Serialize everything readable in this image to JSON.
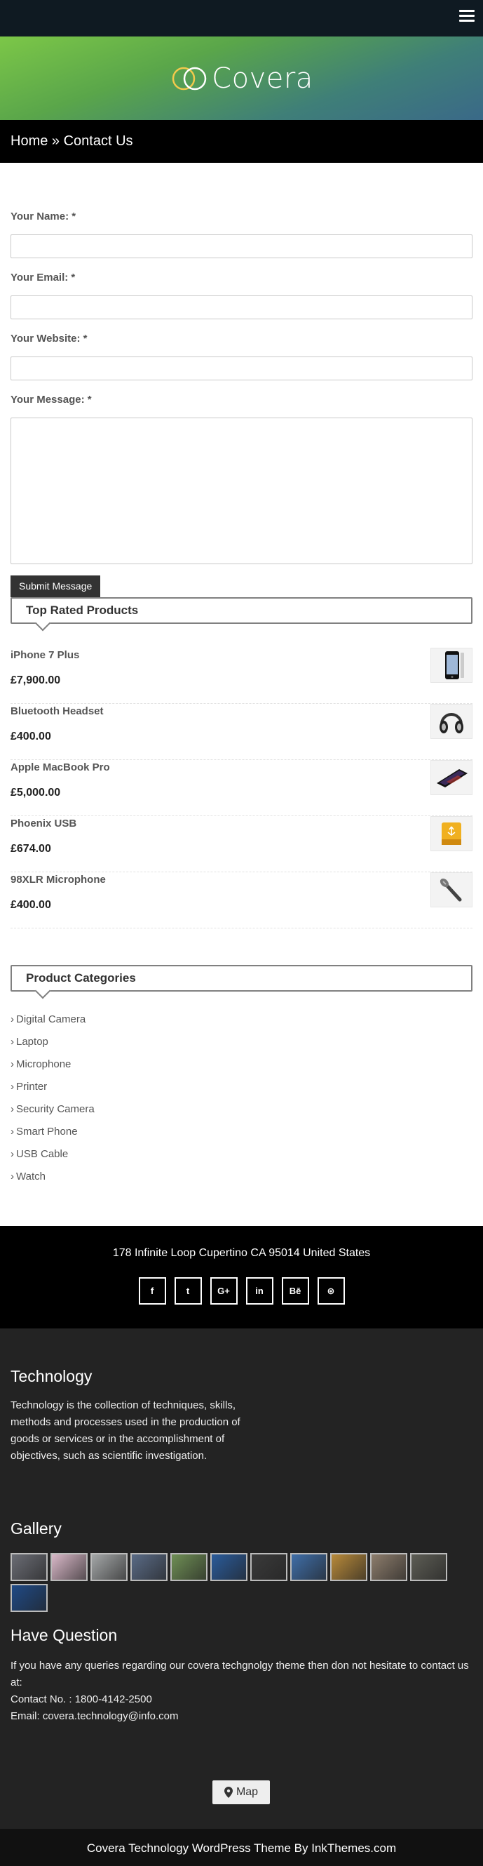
{
  "header": {
    "menu_icon": "hamburger-menu-icon"
  },
  "brand": {
    "name": "Covera",
    "colors": {
      "ring_left": "#f2c94c",
      "ring_right": "#ffffff"
    }
  },
  "breadcrumb": {
    "text": "Home » Contact Us"
  },
  "form": {
    "name_label": "Your Name: *",
    "email_label": "Your Email: *",
    "website_label": "Your Website: *",
    "message_label": "Your Message: *",
    "name_value": "",
    "email_value": "",
    "website_value": "",
    "message_value": "",
    "submit_label": "Submit Message"
  },
  "top_rated": {
    "title": "Top Rated Products",
    "items": [
      {
        "name": "iPhone 7 Plus",
        "price": "£7,900.00",
        "icon": "phone-icon"
      },
      {
        "name": "Bluetooth Headset",
        "price": "£400.00",
        "icon": "headphones-icon"
      },
      {
        "name": "Apple MacBook Pro",
        "price": "£5,000.00",
        "icon": "tablet-icon"
      },
      {
        "name": "Phoenix USB",
        "price": "£674.00",
        "icon": "usb-drive-icon"
      },
      {
        "name": "98XLR Microphone",
        "price": "£400.00",
        "icon": "microphone-icon"
      }
    ]
  },
  "categories": {
    "title": "Product Categories",
    "items": [
      "Digital Camera",
      "Laptop",
      "Microphone",
      "Printer",
      "Security Camera",
      "Smart Phone",
      "USB Cable",
      "Watch"
    ]
  },
  "footer": {
    "address": "178 Infinite Loop Cupertino CA 95014 United States",
    "socials": [
      {
        "label": "f",
        "icon": "facebook-icon"
      },
      {
        "label": "t",
        "icon": "twitter-icon"
      },
      {
        "label": "G+",
        "icon": "google-plus-icon"
      },
      {
        "label": "in",
        "icon": "linkedin-icon"
      },
      {
        "label": "Bē",
        "icon": "behance-icon"
      },
      {
        "label": "⊛",
        "icon": "dribbble-icon"
      }
    ],
    "technology_title": "Technology",
    "technology_text": "Technology is the collection of techniques, skills, methods and processes used in the production of goods or services or in the accomplishment of objectives, such as scientific investigation.",
    "gallery_title": "Gallery",
    "gallery_colors": [
      "#6b6d75",
      "#d9b8c8",
      "#a4a7a8",
      "#5a6b86",
      "#6f8f55",
      "#2a5b9a",
      "#3a3a3a",
      "#3f6ea8",
      "#b88a3a",
      "#8d7d6c",
      "#5d5d55",
      "#1f4a86"
    ],
    "question_title": "Have Question",
    "question_text": "If you have any queries regarding our covera techgnolgy theme then don not hesitate to contact us at:",
    "contact_no": "Contact No. : 1800-4142-2500",
    "email": "Email: covera.technology@info.com",
    "map_label": "Map",
    "map_icon": "map-marker-icon",
    "copyright": "Covera Technology WordPress Theme By InkThemes.com"
  }
}
